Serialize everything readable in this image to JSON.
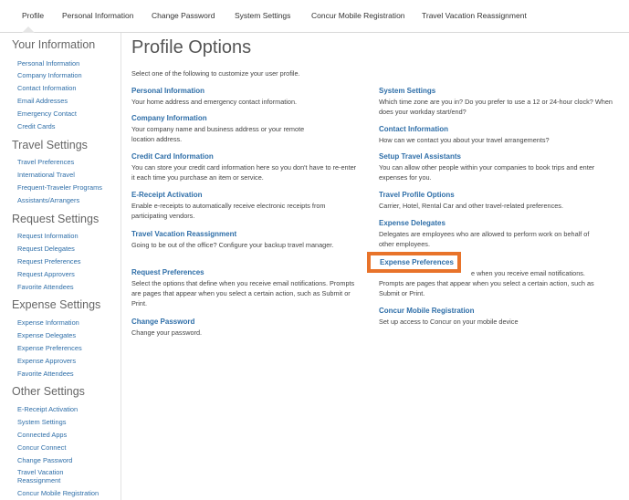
{
  "topnav": {
    "tabs": [
      {
        "label": "Profile"
      },
      {
        "label": "Personal Information"
      },
      {
        "label": "Change Password"
      },
      {
        "label": "System Settings"
      },
      {
        "label": "Concur Mobile Registration"
      },
      {
        "label": "Travel Vacation Reassignment"
      }
    ]
  },
  "sidebar": {
    "your_information": {
      "title": "Your Information",
      "items": [
        "Personal Information",
        "Company Information",
        "Contact Information",
        "Email Addresses",
        "Emergency Contact",
        "Credit Cards"
      ]
    },
    "travel_settings": {
      "title": "Travel Settings",
      "items": [
        "Travel Preferences",
        "International Travel",
        "Frequent-Traveler Programs",
        "Assistants/Arrangers"
      ]
    },
    "request_settings": {
      "title": "Request Settings",
      "items": [
        "Request Information",
        "Request Delegates",
        "Request Preferences",
        "Request Approvers",
        "Favorite Attendees"
      ]
    },
    "expense_settings": {
      "title": "Expense Settings",
      "items": [
        "Expense Information",
        "Expense Delegates",
        "Expense Preferences",
        "Expense Approvers",
        "Favorite Attendees"
      ]
    },
    "other_settings": {
      "title": "Other Settings",
      "items": [
        "E-Receipt Activation",
        "System Settings",
        "Connected Apps",
        "Concur Connect",
        "Change Password",
        "Travel Vacation",
        "Reassignment",
        "Concur Mobile Registration"
      ]
    }
  },
  "main": {
    "title": "Profile Options",
    "intro": "Select one of the following to customize your user profile.",
    "left": [
      {
        "title": "Personal Information",
        "desc": "Your home address and emergency contact information."
      },
      {
        "title": "Company Information",
        "desc": "Your company name and business address or your remote location address."
      },
      {
        "title": "Credit Card Information",
        "desc": "You can store your credit card information here so you don't have to re-enter it each time you purchase an item or service."
      },
      {
        "title": "E-Receipt Activation",
        "desc": "Enable e-receipts to automatically receive electronic receipts from participating vendors."
      },
      {
        "title": "Travel Vacation Reassignment",
        "desc": "Going to be out of the office? Configure your backup travel manager."
      },
      {
        "title": "Request Preferences",
        "desc": "Select the options that define when you receive email notifications. Prompts are pages that appear when you select a certain action, such as Submit or Print."
      },
      {
        "title": "Change Password",
        "desc": "Change your password."
      }
    ],
    "right": [
      {
        "title": "System Settings",
        "desc": "Which time zone are you in? Do you prefer to use a 12 or 24-hour clock? When does your workday start/end?"
      },
      {
        "title": "Contact Information",
        "desc": "How can we contact you about your travel arrangements?"
      },
      {
        "title": "Setup Travel Assistants",
        "desc": "You can allow other people within your companies to book trips and enter expenses for you."
      },
      {
        "title": "Travel Profile Options",
        "desc": "Carrier, Hotel, Rental Car and other travel-related preferences."
      },
      {
        "title": "Expense Delegates",
        "desc": "Delegates are employees who are allowed to perform work on behalf of other employees."
      },
      {
        "title": "Expense Preferences",
        "desc_tail": "e when you receive email notifications.",
        "desc": "Prompts are pages that appear when you select a certain action, such as Submit or Print."
      },
      {
        "title": "Concur Mobile Registration",
        "desc": "Set up access to Concur on your mobile device"
      }
    ]
  },
  "colors": {
    "link": "#2e6ea8",
    "highlight": "#e8732a"
  }
}
